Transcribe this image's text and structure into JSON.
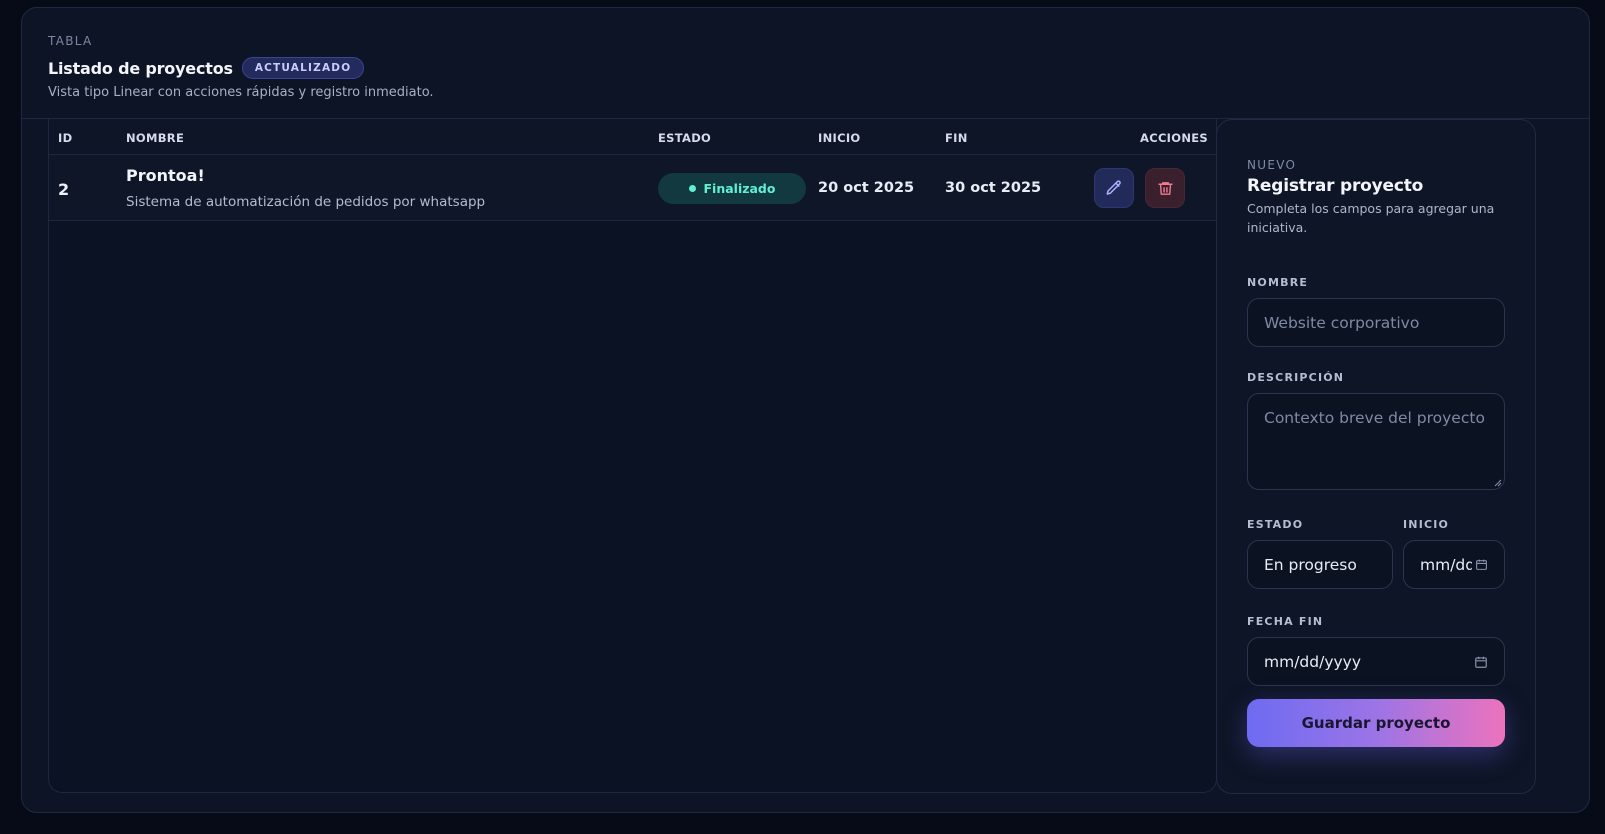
{
  "header": {
    "eyebrow": "TABLA",
    "title": "Listado de proyectos",
    "badge": "ACTUALIZADO",
    "subtitle": "Vista tipo Linear con acciones rápidas y registro inmediato."
  },
  "table": {
    "columns": [
      "ID",
      "NOMBRE",
      "ESTADO",
      "INICIO",
      "FIN",
      "ACCIONES"
    ],
    "rows": [
      {
        "id": "2",
        "name": "Prontoa!",
        "description": "Sistema de automatización de pedidos por whatsapp",
        "status": "Finalizado",
        "start": "20 oct 2025",
        "end": "30 oct 2025"
      }
    ]
  },
  "icons": {
    "edit": "pencil-icon",
    "delete": "trash-icon",
    "calendar": "calendar-icon"
  },
  "colors": {
    "status_finalizado": "#5ff0d4",
    "edit_accent": "#a9b2ff",
    "delete_accent": "#f07a90",
    "button_gradient_start": "#6e6bf2",
    "button_gradient_end": "#ec73bd"
  },
  "form": {
    "eyebrow": "NUEVO",
    "title": "Registrar proyecto",
    "subtitle": "Completa los campos para agregar una iniciativa.",
    "name_label": "NOMBRE",
    "name_placeholder": "Website corporativo",
    "description_label": "DESCRIPCIÓN",
    "description_placeholder": "Contexto breve del proyecto",
    "status_label": "ESTADO",
    "status_value": "En progreso",
    "start_label": "INICIO",
    "start_value": "mm/dd/yyyy",
    "end_label": "FECHA FIN",
    "end_value": "mm/dd/yyyy",
    "submit_label": "Guardar proyecto"
  }
}
